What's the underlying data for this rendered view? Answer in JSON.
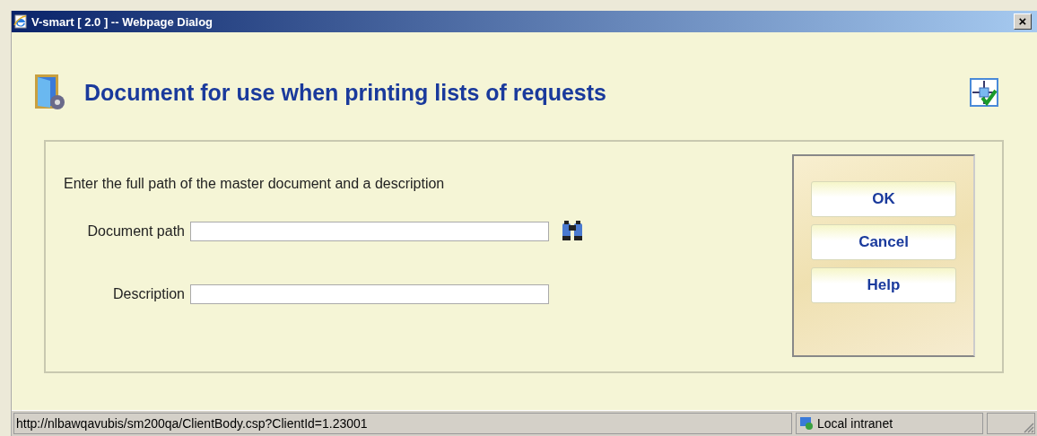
{
  "window": {
    "title": "V-smart [ 2.0 ] -- Webpage Dialog",
    "close": "×"
  },
  "heading": "Document for use when printing lists of requests",
  "form": {
    "instruction": "Enter the full path of the master document and a description",
    "fields": [
      {
        "label": "Document path",
        "browse": true
      },
      {
        "label": "Description",
        "browse": false
      }
    ]
  },
  "buttons": [
    "OK",
    "Cancel",
    "Help"
  ],
  "status_bar": {
    "url": "http://nlbawqavubis/sm200qa/ClientBody.csp?ClientId=1.23001",
    "zone": "Local intranet"
  }
}
